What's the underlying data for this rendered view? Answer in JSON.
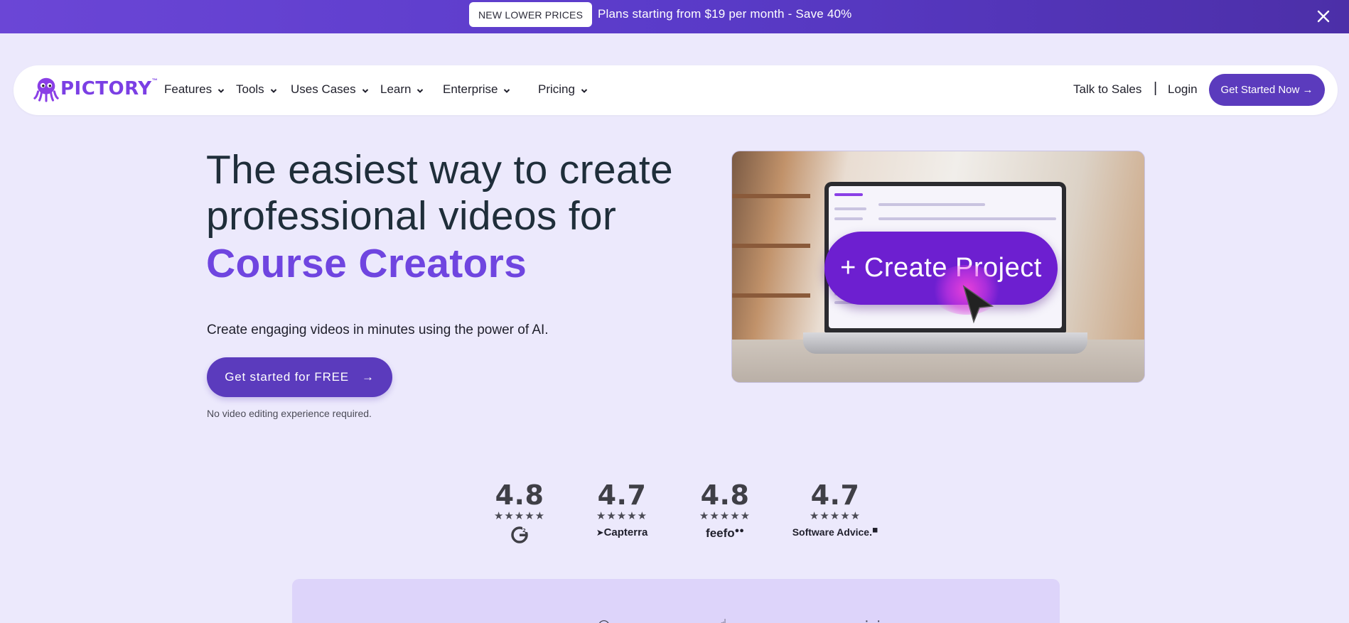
{
  "banner": {
    "pill": "NEW LOWER PRICES",
    "text": "Plans starting from $19 per month - Save 40%",
    "close_icon": "close-icon"
  },
  "nav": {
    "logo_text": "PICTORY",
    "logo_tm": "™",
    "items": [
      {
        "label": "Features"
      },
      {
        "label": "Tools"
      },
      {
        "label": "Uses Cases"
      },
      {
        "label": "Learn"
      },
      {
        "label": "Enterprise"
      },
      {
        "label": "Pricing"
      }
    ],
    "talk_to_sales": "Talk to Sales",
    "separator": "|",
    "login": "Login",
    "cta": "Get Started Now →"
  },
  "hero": {
    "title_line1": "The easiest way to create",
    "title_line2": "professional videos for",
    "title_accent": "Course Creators",
    "subtitle": "Create engaging videos in minutes using the power of AI.",
    "cta": "Get started for FREE",
    "cta_arrow": "→",
    "note": "No video editing experience required.",
    "media_button": "+ Create Project"
  },
  "ratings": [
    {
      "score": "4.8",
      "stars": "★★★★★",
      "brand": "G2"
    },
    {
      "score": "4.7",
      "stars": "★★★★★",
      "brand": "Capterra"
    },
    {
      "score": "4.8",
      "stars": "★★★★★",
      "brand": "feefo"
    },
    {
      "score": "4.7",
      "stars": "★★★★★",
      "brand": "Software Advice."
    }
  ],
  "colors": {
    "brand_purple": "#5b3bbd",
    "accent_purple": "#6f45e0",
    "page_bg": "#ece9fc"
  }
}
